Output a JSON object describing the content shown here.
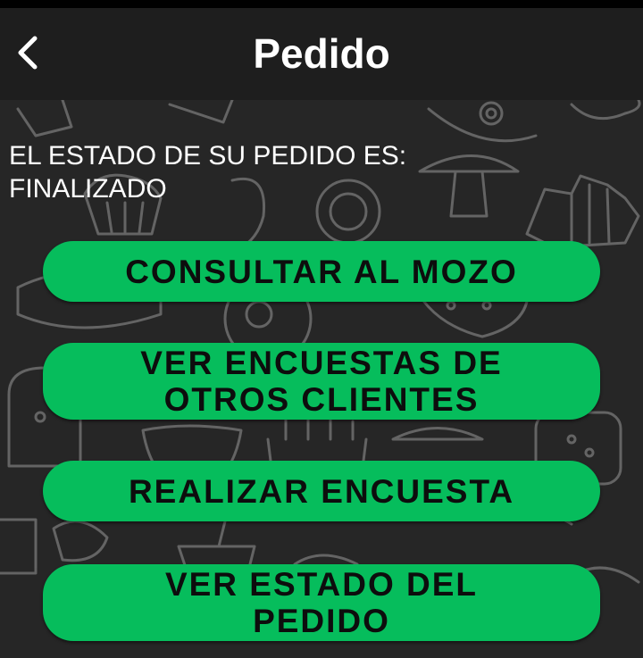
{
  "app_bar": {
    "title": "Pedido",
    "back_icon": "chevron-left-icon"
  },
  "status": {
    "line1": "EL ESTADO DE SU PEDIDO ES:",
    "line2": "FINALIZADO"
  },
  "actions": [
    {
      "lines": [
        "CONSULTAR AL MOZO"
      ]
    },
    {
      "lines": [
        "VER ENCUESTAS DE",
        "OTROS CLIENTES"
      ]
    },
    {
      "lines": [
        "REALIZAR ENCUESTA"
      ]
    },
    {
      "lines": [
        "VER ESTADO DEL",
        "PEDIDO"
      ]
    }
  ],
  "colors": {
    "app_bar": "#1e1e1e",
    "background": "#262626",
    "button": "#06bd5c",
    "button_text": "#0d0d0d",
    "text": "#ffffff",
    "doodle_stroke": "#6f6f6f"
  }
}
